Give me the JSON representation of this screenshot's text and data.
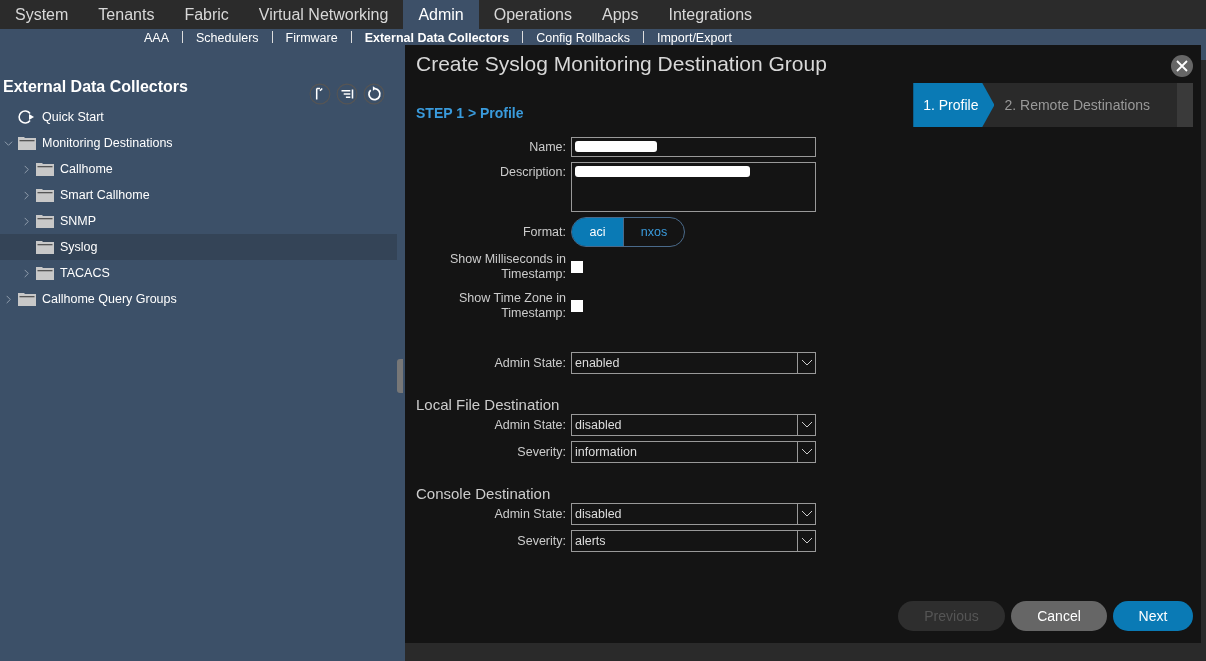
{
  "top_nav": {
    "tabs": [
      {
        "label": "System",
        "selected": false
      },
      {
        "label": "Tenants",
        "selected": false
      },
      {
        "label": "Fabric",
        "selected": false
      },
      {
        "label": "Virtual Networking",
        "selected": false
      },
      {
        "label": "Admin",
        "selected": true
      },
      {
        "label": "Operations",
        "selected": false
      },
      {
        "label": "Apps",
        "selected": false
      },
      {
        "label": "Integrations",
        "selected": false
      }
    ]
  },
  "sub_nav": {
    "items": [
      {
        "label": "AAA",
        "selected": false
      },
      {
        "label": "Schedulers",
        "selected": false
      },
      {
        "label": "Firmware",
        "selected": false
      },
      {
        "label": "External Data Collectors",
        "selected": true
      },
      {
        "label": "Config Rollbacks",
        "selected": false
      },
      {
        "label": "Import/Export",
        "selected": false
      }
    ]
  },
  "sidebar": {
    "title": "External Data Collectors",
    "tree": [
      {
        "label": "Quick Start",
        "kind": "action",
        "selected": false
      },
      {
        "label": "Monitoring Destinations",
        "kind": "folder",
        "selected": false,
        "expanded": true,
        "children": [
          {
            "label": "Callhome",
            "kind": "folder",
            "selected": false,
            "expanded": false
          },
          {
            "label": "Smart Callhome",
            "kind": "folder",
            "selected": false,
            "expanded": false
          },
          {
            "label": "SNMP",
            "kind": "folder",
            "selected": false,
            "expanded": false
          },
          {
            "label": "Syslog",
            "kind": "folder",
            "selected": true
          },
          {
            "label": "TACACS",
            "kind": "folder",
            "selected": false,
            "expanded": false
          }
        ]
      },
      {
        "label": "Callhome Query Groups",
        "kind": "folder",
        "selected": false,
        "expanded": false
      }
    ]
  },
  "dialog": {
    "title": "Create Syslog Monitoring Destination Group",
    "steps": [
      {
        "label": "1. Profile",
        "selected": true
      },
      {
        "label": "2. Remote Destinations",
        "selected": false
      }
    ],
    "step_heading": "STEP 1 > Profile",
    "sections": [
      {
        "fields": [
          {
            "kind": "text",
            "label": "Name:",
            "redacted": true
          },
          {
            "kind": "textarea",
            "label": "Description:",
            "redacted": true
          },
          {
            "kind": "segmented",
            "label": "Format:",
            "options": [
              {
                "label": "aci",
                "selected": true
              },
              {
                "label": "nxos",
                "selected": false
              }
            ]
          },
          {
            "kind": "checkbox",
            "label": "Show Milliseconds in Timestamp:",
            "checked": false
          },
          {
            "kind": "checkbox",
            "label": "Show Time Zone in Timestamp:",
            "checked": false
          },
          {
            "kind": "select",
            "label": "Admin State:",
            "value": "enabled"
          }
        ]
      },
      {
        "heading": "Local File Destination",
        "fields": [
          {
            "kind": "select",
            "label": "Admin State:",
            "value": "disabled"
          },
          {
            "kind": "select",
            "label": "Severity:",
            "value": "information"
          }
        ]
      },
      {
        "heading": "Console Destination",
        "fields": [
          {
            "kind": "select",
            "label": "Admin State:",
            "value": "disabled"
          },
          {
            "kind": "select",
            "label": "Severity:",
            "value": "alerts"
          }
        ]
      }
    ],
    "buttons": [
      {
        "label": "Previous",
        "kind": "secondary",
        "disabled": true
      },
      {
        "label": "Cancel",
        "kind": "secondary",
        "disabled": false
      },
      {
        "label": "Next",
        "kind": "primary",
        "disabled": false
      }
    ]
  }
}
